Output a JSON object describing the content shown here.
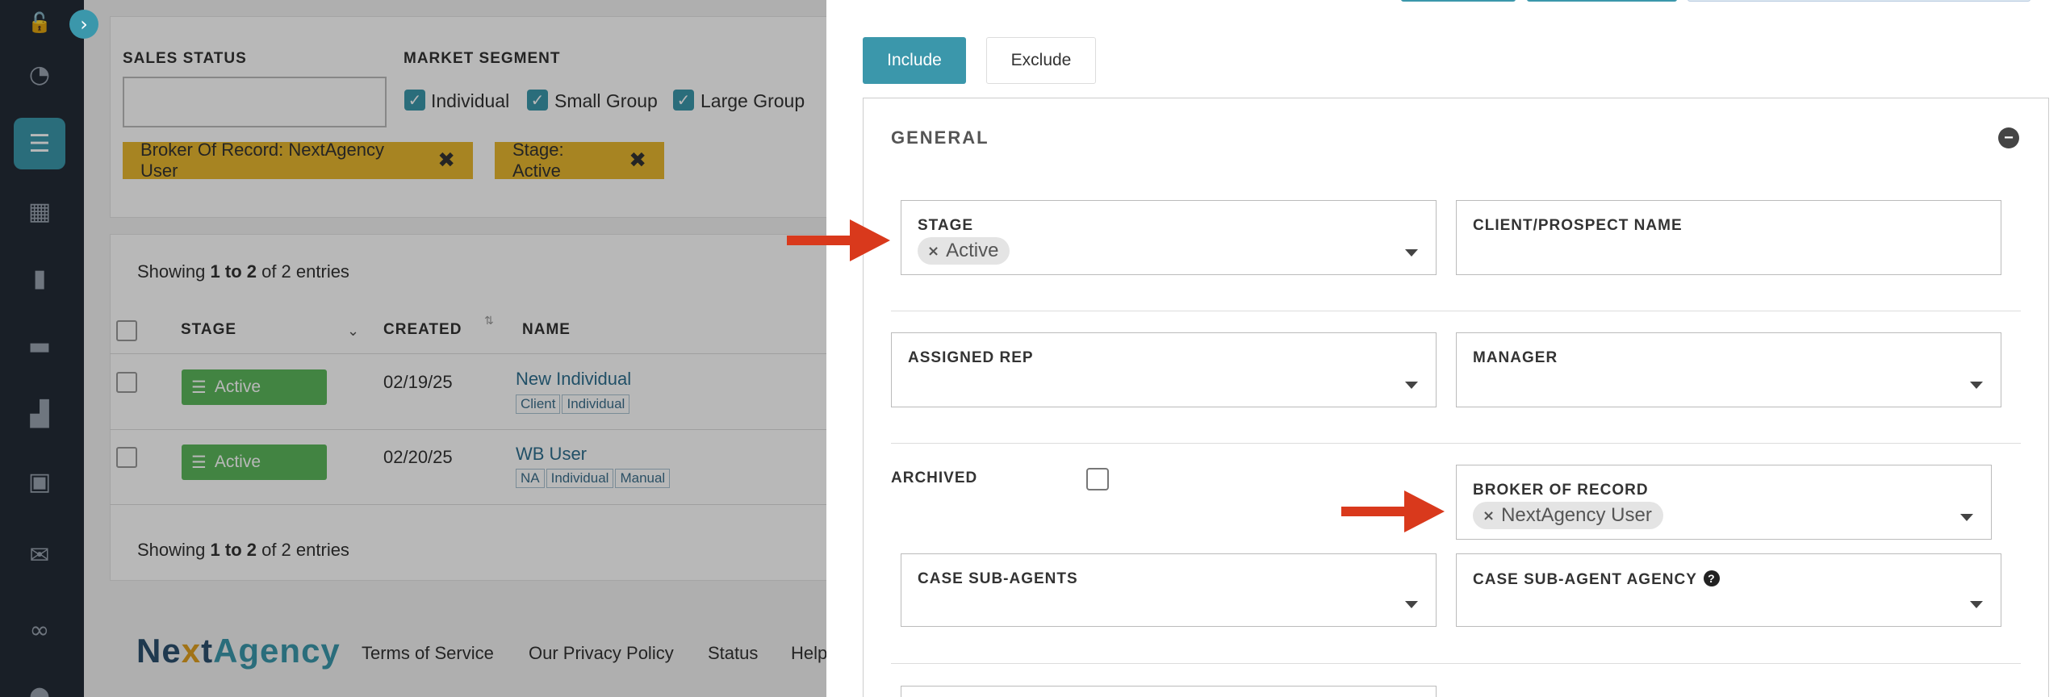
{
  "sidebar": {
    "toggle_icon": "chevron-right-icon",
    "items": [
      {
        "icon": "lock-open-icon",
        "glyph": "🔓"
      },
      {
        "icon": "pie-chart-icon",
        "glyph": "◔"
      },
      {
        "icon": "list-icon",
        "glyph": "☰",
        "active": true
      },
      {
        "icon": "grid-icon",
        "glyph": "▦"
      },
      {
        "icon": "book-icon",
        "glyph": "▮"
      },
      {
        "icon": "briefcase-icon",
        "glyph": "▬"
      },
      {
        "icon": "bar-chart-icon",
        "glyph": "▟"
      },
      {
        "icon": "calendar-check-icon",
        "glyph": "▣"
      },
      {
        "icon": "envelope-icon",
        "glyph": "✉"
      },
      {
        "icon": "handshake-icon",
        "glyph": "∞"
      },
      {
        "icon": "user-icon",
        "glyph": "●"
      }
    ]
  },
  "filters": {
    "sales_status_label": "SALES STATUS",
    "market_segment_label": "MARKET SEGMENT",
    "segments": [
      "Individual",
      "Small Group",
      "Large Group"
    ],
    "active_chips": [
      "Broker Of Record: NextAgency User",
      "Stage: Active"
    ]
  },
  "table": {
    "showing_top": {
      "prefix": "Showing ",
      "range": "1 to 2",
      "suffix": " of 2 entries"
    },
    "showing_bottom": {
      "prefix": "Showing ",
      "range": "1 to 2",
      "suffix": " of 2 entries"
    },
    "headers": {
      "stage": "STAGE",
      "created": "CREATED",
      "name": "NAME"
    },
    "rows": [
      {
        "stage": "Active",
        "created": "02/19/25",
        "name": "New Individual",
        "tags": [
          "Client",
          "Individual"
        ]
      },
      {
        "stage": "Active",
        "created": "02/20/25",
        "name": "WB User",
        "tags": [
          "NA",
          "Individual",
          "Manual"
        ]
      }
    ]
  },
  "footer": {
    "logo_part1": "Ne",
    "logo_x": "x",
    "logo_part2": "t",
    "logo_part3": "Agency",
    "links": [
      "Terms of Service",
      "Our Privacy Policy",
      "Status",
      "Help"
    ]
  },
  "panel": {
    "include_label": "Include",
    "exclude_label": "Exclude",
    "section_title": "GENERAL",
    "fields": {
      "stage": {
        "label": "STAGE",
        "value": "Active"
      },
      "client_name": {
        "label": "CLIENT/PROSPECT NAME"
      },
      "assigned_rep": {
        "label": "ASSIGNED REP"
      },
      "manager": {
        "label": "MANAGER"
      },
      "archived": {
        "label": "ARCHIVED"
      },
      "broker_of_record": {
        "label": "BROKER OF RECORD",
        "value": "NextAgency User"
      },
      "case_sub_agents": {
        "label": "CASE SUB-AGENTS"
      },
      "case_sub_agent_agency": {
        "label": "CASE SUB-AGENT AGENCY"
      }
    }
  },
  "colors": {
    "accent": "#3b97ab",
    "chip": "#e8b730",
    "active_badge": "#5cb85c",
    "arrow": "#d9391c",
    "sidebar": "#232b36"
  }
}
